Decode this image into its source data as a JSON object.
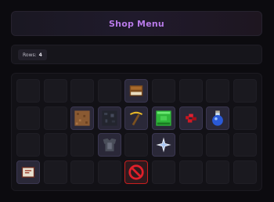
{
  "header": {
    "title": "Shop Menu"
  },
  "rows": {
    "label": "Rows:",
    "value": "4"
  },
  "grid": {
    "columns": 9,
    "rows": 4,
    "items": [
      {
        "row": 0,
        "col": 4,
        "icon": "book-icon"
      },
      {
        "row": 1,
        "col": 2,
        "icon": "dirt-block-icon"
      },
      {
        "row": 1,
        "col": 3,
        "icon": "dark-ore-block-icon"
      },
      {
        "row": 1,
        "col": 4,
        "icon": "golden-pickaxe-icon"
      },
      {
        "row": 1,
        "col": 5,
        "icon": "emerald-block-icon"
      },
      {
        "row": 1,
        "col": 6,
        "icon": "redstone-icon"
      },
      {
        "row": 1,
        "col": 7,
        "icon": "potion-icon"
      },
      {
        "row": 2,
        "col": 3,
        "icon": "chestplate-icon"
      },
      {
        "row": 2,
        "col": 5,
        "icon": "nether-star-icon"
      },
      {
        "row": 3,
        "col": 0,
        "icon": "enchanted-book-icon"
      },
      {
        "row": 3,
        "col": 4,
        "icon": "barrier-icon"
      }
    ]
  },
  "colors": {
    "title": "#b87ae8",
    "barrier_border": "#c81e1e",
    "emerald": "#2fb53a",
    "redstone": "#c8141e"
  }
}
